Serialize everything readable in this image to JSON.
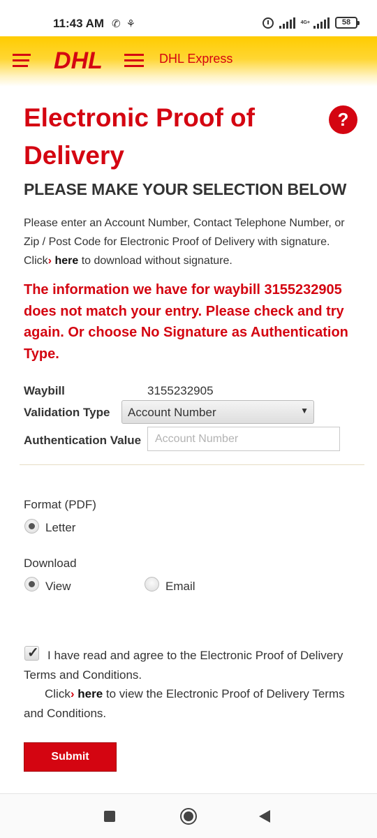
{
  "status_bar": {
    "time": "11:43 AM",
    "network_tag": "4G+",
    "battery": "58",
    "icons": [
      "whatsapp-icon",
      "notification-icon",
      "alarm-icon",
      "signal-icon",
      "signal-4g-icon",
      "battery-icon"
    ]
  },
  "header": {
    "logo_text": "DHL",
    "title": "DHL Express"
  },
  "page": {
    "title": "Electronic Proof of Delivery",
    "help_label": "?",
    "subheading": "PLEASE MAKE YOUR SELECTION BELOW",
    "intro_text": "Please enter an Account Number, Contact Telephone Number, or Zip / Post Code for Electronic Proof of Delivery with signature. Click",
    "intro_link": "here",
    "intro_suffix": "to download without signature.",
    "error_message": "The information we have for waybill 3155232905 does not match your entry. Please check and try again. Or choose No Signature as Authentication Type."
  },
  "form": {
    "waybill_label": "Waybill",
    "waybill_value": "3155232905",
    "validation_label": "Validation Type",
    "validation_selected": "Account Number",
    "auth_label": "Authentication Value",
    "auth_placeholder": "Account Number",
    "auth_value": "",
    "format_label": "Format (PDF)",
    "format_options": [
      {
        "label": "Letter",
        "selected": true
      }
    ],
    "download_label": "Download",
    "download_options": [
      {
        "label": "View",
        "selected": true
      },
      {
        "label": "Email",
        "selected": false
      }
    ],
    "terms_checked": true,
    "terms_text": "I have read and agree to the Electronic Proof of Delivery Terms and Conditions.",
    "terms_click": "Click",
    "terms_link": "here",
    "terms_suffix": "to view the Electronic Proof of Delivery Terms and Conditions.",
    "submit_label": "Submit"
  },
  "colors": {
    "brand_red": "#d40511",
    "brand_yellow": "#ffcc00"
  }
}
